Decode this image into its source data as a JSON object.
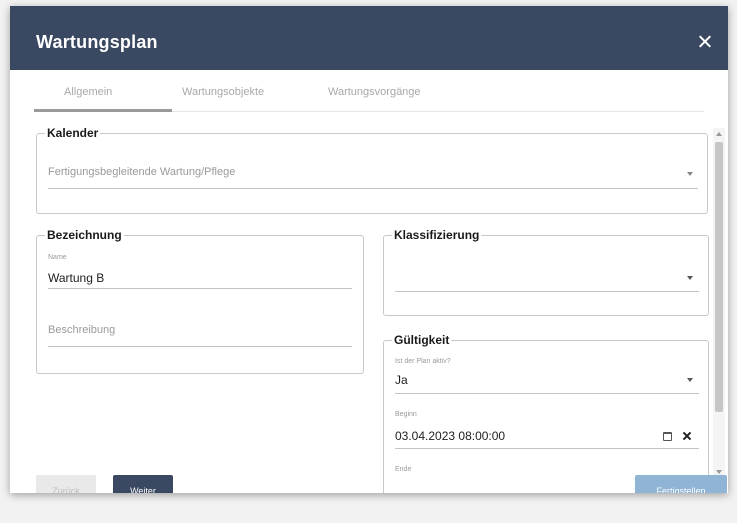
{
  "dialog": {
    "title": "Wartungsplan"
  },
  "tabs": [
    {
      "label": "Allgemein"
    },
    {
      "label": "Wartungsobjekte"
    },
    {
      "label": "Wartungsvorgänge"
    }
  ],
  "kalender": {
    "legend": "Kalender",
    "value": "Fertigungsbegleitende Wartung/Pflege"
  },
  "bezeichnung": {
    "legend": "Bezeichnung",
    "name_label": "Name",
    "name_value": "Wartung B",
    "beschreibung_label": "Beschreibung"
  },
  "klassifizierung": {
    "legend": "Klassifizierung",
    "value": ""
  },
  "gueltigkeit": {
    "legend": "Gültigkeit",
    "aktiv_label": "Ist der Plan aktiv?",
    "aktiv_value": "Ja",
    "beginn_label": "Beginn",
    "beginn_value": "03.04.2023 08:00:00",
    "ende_label": "Ende"
  },
  "buttons": {
    "back": "Zurück",
    "next": "Weiter",
    "finish": "Fertigstellen"
  },
  "colors": {
    "header": "#3a4862",
    "primary_button": "#3a4862",
    "finish_button": "#8fb4d6"
  }
}
